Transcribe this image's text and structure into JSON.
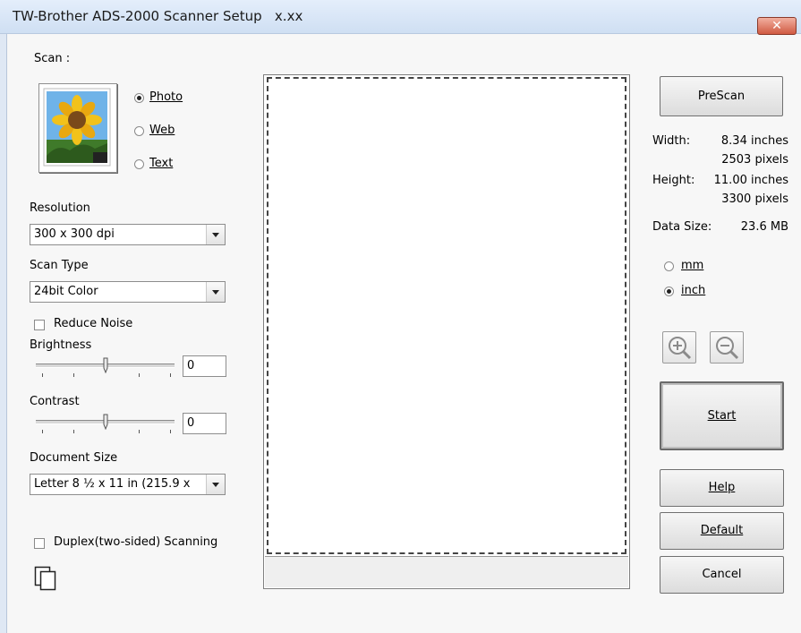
{
  "window": {
    "title": "TW-Brother ADS-2000 Scanner Setup",
    "version": "x.xx",
    "close_label": "✕"
  },
  "scan": {
    "label": "Scan :",
    "options": [
      {
        "label": "Photo",
        "selected": true
      },
      {
        "label": "Web",
        "selected": false
      },
      {
        "label": "Text",
        "selected": false
      }
    ]
  },
  "resolution": {
    "label": "Resolution",
    "value": "300 x 300 dpi"
  },
  "scan_type": {
    "label": "Scan Type",
    "value": "24bit Color"
  },
  "reduce_noise": {
    "label": "Reduce Noise",
    "checked": false
  },
  "brightness": {
    "label": "Brightness",
    "value": "0",
    "level": 0.5
  },
  "contrast": {
    "label": "Contrast",
    "value": "0",
    "level": 0.5
  },
  "document_size": {
    "label": "Document Size",
    "value": "Letter 8 ½ x 11 in (215.9 x"
  },
  "duplex": {
    "label": "Duplex(two-sided) Scanning",
    "checked": false
  },
  "info": {
    "width_label": "Width:",
    "width_inches": "8.34 inches",
    "width_pixels": "2503 pixels",
    "height_label": "Height:",
    "height_inches": "11.00 inches",
    "height_pixels": "3300 pixels",
    "data_size_label": "Data Size:",
    "data_size_value": "23.6 MB"
  },
  "units": {
    "mm_label": "mm",
    "inch_label": "inch",
    "selected": "inch"
  },
  "buttons": {
    "prescan": "PreScan",
    "start": "Start",
    "help": "Help",
    "default": "Default",
    "cancel": "Cancel"
  },
  "icons": {
    "zoom_in": "zoom-in-icon",
    "zoom_out": "zoom-out-icon",
    "photo_thumbnail": "sunflower-photo-icon",
    "duplex": "duplex-pages-icon"
  },
  "colors": {
    "title_bar": "#cfdff3",
    "close_button": "#d05a42"
  }
}
